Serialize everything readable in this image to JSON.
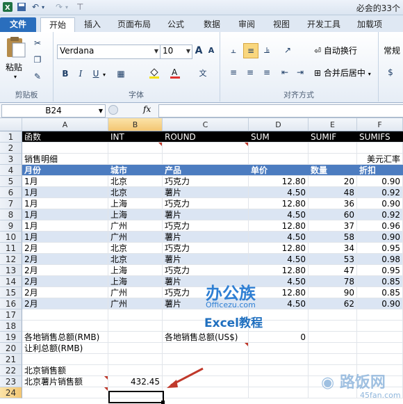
{
  "window": {
    "title": "必会的33个"
  },
  "tabs": [
    "文件",
    "开始",
    "插入",
    "页面布局",
    "公式",
    "数据",
    "审阅",
    "视图",
    "开发工具",
    "加载项"
  ],
  "ribbon": {
    "paste_label": "粘贴",
    "clipboard_label": "剪贴板",
    "font_name": "Verdana",
    "font_size": "10",
    "font_group_label": "字体",
    "grow_font": "A",
    "shrink_font": "A",
    "bold": "B",
    "italic": "I",
    "underline": "U",
    "wrap_text": "自动换行",
    "merge_center": "合并后居中",
    "align_group_label": "对齐方式",
    "number_format": "常规",
    "wen": "文"
  },
  "formula_bar": {
    "name_box": "B24",
    "fx": "fx",
    "formula": ""
  },
  "columns": [
    "A",
    "B",
    "C",
    "D",
    "E",
    "F"
  ],
  "selected_column": "B",
  "selected_row": "24",
  "rows": [
    {
      "n": "1",
      "type": "dark",
      "cells": [
        "函数",
        "INT",
        "ROUND",
        "SUM",
        "SUMIF",
        "SUMIFS"
      ]
    },
    {
      "n": "2",
      "type": "plain",
      "cells": [
        "",
        "",
        "",
        "",
        "",
        ""
      ]
    },
    {
      "n": "3",
      "type": "plain",
      "cells": [
        "销售明细",
        "",
        "",
        "",
        "",
        "美元汇率"
      ]
    },
    {
      "n": "4",
      "type": "head",
      "cells": [
        "月份",
        "城市",
        "产品",
        "单价",
        "数量",
        "折扣"
      ]
    },
    {
      "n": "5",
      "type": "plain",
      "cells": [
        "1月",
        "北京",
        "巧克力",
        "12.80",
        "20",
        "0.90"
      ]
    },
    {
      "n": "6",
      "type": "band",
      "cells": [
        "1月",
        "北京",
        "薯片",
        "4.50",
        "48",
        "0.92"
      ]
    },
    {
      "n": "7",
      "type": "plain",
      "cells": [
        "1月",
        "上海",
        "巧克力",
        "12.80",
        "36",
        "0.90"
      ]
    },
    {
      "n": "8",
      "type": "band",
      "cells": [
        "1月",
        "上海",
        "薯片",
        "4.50",
        "60",
        "0.92"
      ]
    },
    {
      "n": "9",
      "type": "plain",
      "cells": [
        "1月",
        "广州",
        "巧克力",
        "12.80",
        "37",
        "0.96"
      ]
    },
    {
      "n": "10",
      "type": "band",
      "cells": [
        "1月",
        "广州",
        "薯片",
        "4.50",
        "58",
        "0.90"
      ]
    },
    {
      "n": "11",
      "type": "plain",
      "cells": [
        "2月",
        "北京",
        "巧克力",
        "12.80",
        "34",
        "0.95"
      ]
    },
    {
      "n": "12",
      "type": "band",
      "cells": [
        "2月",
        "北京",
        "薯片",
        "4.50",
        "53",
        "0.98"
      ]
    },
    {
      "n": "13",
      "type": "plain",
      "cells": [
        "2月",
        "上海",
        "巧克力",
        "12.80",
        "47",
        "0.95"
      ]
    },
    {
      "n": "14",
      "type": "band",
      "cells": [
        "2月",
        "上海",
        "薯片",
        "4.50",
        "78",
        "0.85"
      ]
    },
    {
      "n": "15",
      "type": "plain",
      "cells": [
        "2月",
        "广州",
        "巧克力",
        "12.80",
        "90",
        "0.85"
      ]
    },
    {
      "n": "16",
      "type": "band",
      "cells": [
        "2月",
        "广州",
        "薯片",
        "4.50",
        "62",
        "0.90"
      ]
    },
    {
      "n": "17",
      "type": "plain",
      "cells": [
        "",
        "",
        "",
        "",
        "",
        ""
      ]
    },
    {
      "n": "18",
      "type": "plain",
      "cells": [
        "",
        "",
        "",
        "",
        "",
        ""
      ]
    },
    {
      "n": "19",
      "type": "plain",
      "cells": [
        "各地销售总额(RMB)",
        "",
        "各地销售总额(US$)",
        "0",
        "",
        ""
      ]
    },
    {
      "n": "20",
      "type": "plain",
      "cells": [
        "让利总额(RMB)",
        "",
        "",
        "",
        "",
        ""
      ]
    },
    {
      "n": "21",
      "type": "plain",
      "cells": [
        "",
        "",
        "",
        "",
        "",
        ""
      ]
    },
    {
      "n": "22",
      "type": "plain",
      "cells": [
        "北京销售额",
        "",
        "",
        "",
        "",
        ""
      ]
    },
    {
      "n": "23",
      "type": "plain",
      "cells": [
        "北京薯片销售额",
        "432.45",
        "",
        "",
        "",
        ""
      ]
    },
    {
      "n": "24",
      "type": "plain",
      "cells": [
        "",
        "",
        "",
        "",
        "",
        ""
      ]
    }
  ],
  "watermarks": {
    "logo_cn": "办公族",
    "logo_url": "Officezu.com",
    "excel_tutorial": "Excel教程",
    "site_cn": "路饭网",
    "site_url": "45fan.com"
  },
  "colors": {
    "header_blue": "#4c7cc0",
    "band": "#dbe5f3",
    "file_tab": "#2a6ebd",
    "arrow": "#c0392b"
  }
}
